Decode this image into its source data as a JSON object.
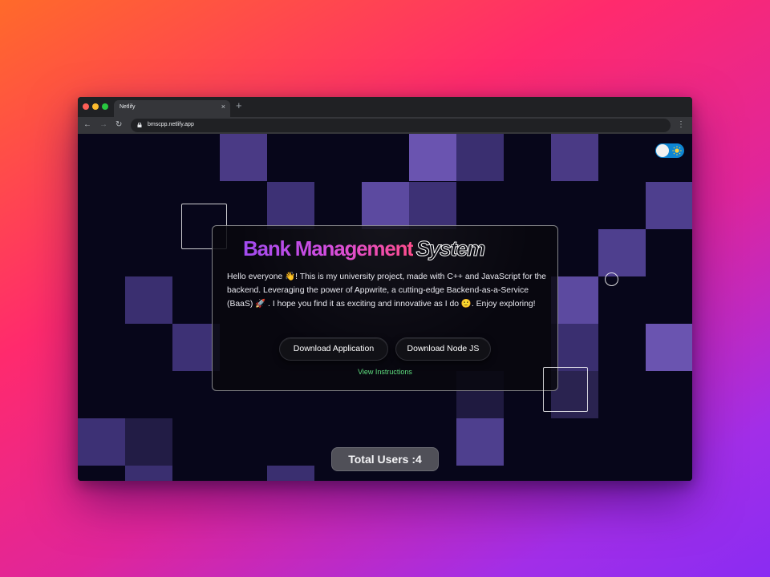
{
  "browser": {
    "tab_title": "Netlify",
    "tab_close": "×",
    "new_tab": "+",
    "back": "←",
    "forward": "→",
    "reload": "↻",
    "url": "bmscpp.netlify.app",
    "menu": "⋮"
  },
  "theme_toggle": {
    "state": "light",
    "icon": "sun-icon"
  },
  "hero": {
    "title_gradient": "Bank Management",
    "title_outline": "System",
    "description": "Hello everyone 👋! This is my university project, made with C++ and JavaScript for the backend. Leveraging the power of Appwrite, a cutting-edge Backend-as-a-Service (BaaS) 🚀 . I hope you find it as exciting and innovative as I do 🙂. Enjoy exploring!",
    "download_app_label": "Download Application",
    "download_node_label": "Download Node JS",
    "instructions_link": "View Instructions"
  },
  "footer": {
    "total_users": "Total Users :4"
  },
  "colors": {
    "accent_purple": "#a14bf0",
    "accent_pink": "#ff4d8d",
    "link_green": "#5fde7f",
    "toggle_blue": "#0e86d4"
  }
}
